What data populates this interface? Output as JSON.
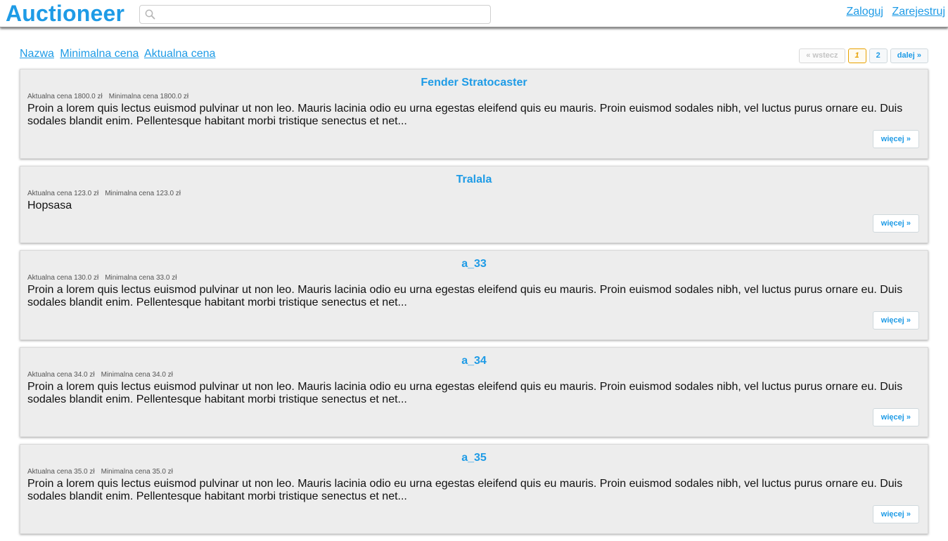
{
  "header": {
    "logo": "Auctioneer",
    "search": {
      "placeholder": "",
      "value": ""
    },
    "login": "Zaloguj",
    "register": "Zarejestruj"
  },
  "sort": {
    "name": "Nazwa",
    "min_price": "Minimalna cena",
    "current_price": "Aktualna cena"
  },
  "pager": {
    "prev": "« wstecz",
    "page1": "1",
    "page2": "2",
    "next": "dalej »"
  },
  "auctions": [
    {
      "title": "Fender Stratocaster",
      "current": "Aktualna cena 1800.0 zł",
      "minimum": "Minimalna cena 1800.0 zł",
      "description": "Proin a lorem quis lectus euismod pulvinar ut non leo. Mauris lacinia odio eu urna egestas eleifend quis eu mauris. Proin euismod sodales nibh, vel luctus purus ornare eu. Duis sodales blandit enim. Pellentesque habitant morbi tristique senectus et net...",
      "more": "więcej »"
    },
    {
      "title": "Tralala",
      "current": "Aktualna cena 123.0 zł",
      "minimum": "Minimalna cena 123.0 zł",
      "description": "Hopsasa",
      "more": "więcej »"
    },
    {
      "title": "a_33",
      "current": "Aktualna cena 130.0 zł",
      "minimum": "Minimalna cena 33.0 zł",
      "description": "Proin a lorem quis lectus euismod pulvinar ut non leo. Mauris lacinia odio eu urna egestas eleifend quis eu mauris. Proin euismod sodales nibh, vel luctus purus ornare eu. Duis sodales blandit enim. Pellentesque habitant morbi tristique senectus et net...",
      "more": "więcej »"
    },
    {
      "title": "a_34",
      "current": "Aktualna cena 34.0 zł",
      "minimum": "Minimalna cena 34.0 zł",
      "description": "Proin a lorem quis lectus euismod pulvinar ut non leo. Mauris lacinia odio eu urna egestas eleifend quis eu mauris. Proin euismod sodales nibh, vel luctus purus ornare eu. Duis sodales blandit enim. Pellentesque habitant morbi tristique senectus et net...",
      "more": "więcej »"
    },
    {
      "title": "a_35",
      "current": "Aktualna cena 35.0 zł",
      "minimum": "Minimalna cena 35.0 zł",
      "description": "Proin a lorem quis lectus euismod pulvinar ut non leo. Mauris lacinia odio eu urna egestas eleifend quis eu mauris. Proin euismod sodales nibh, vel luctus purus ornare eu. Duis sodales blandit enim. Pellentesque habitant morbi tristique senectus et net...",
      "more": "więcej »"
    }
  ]
}
